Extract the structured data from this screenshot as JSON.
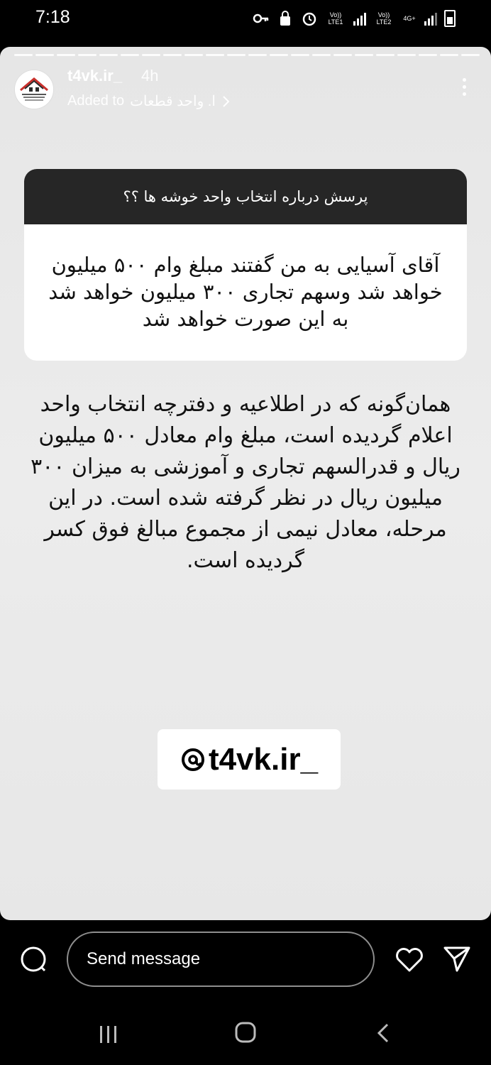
{
  "status_bar": {
    "time": "7:18",
    "sim1_label": "Vo)) LTE1",
    "sim2_label": "Vo)) LTE2",
    "network_label": "4G+"
  },
  "story": {
    "username": "t4vk.ir_",
    "time_ago": "4h",
    "added_prefix": "Added to",
    "highlight_name": "ا. واحد قطعات",
    "question_title": "پرسش درباره انتخاب واحد خوشه ها ؟؟",
    "question_body": "آقای آسیایی به من گفتند مبلغ وام ۵۰۰ میلیون خواهد شد وسهم تجاری ۳۰۰ میلیون خواهد شد به این صورت خواهد شد",
    "answer_text": "همان‌گونه که در اطلاعیه و دفترچه انتخاب واحد اعلام گردیده است، مبلغ وام معادل ۵۰۰ میلیون ریال و قدرالسهم تجاری و آموزشی به میزان ۳۰۰ میلیون ریال در نظر گرفته شده است. در این مرحله، معادل نیمی از مجموع مبالغ فوق کسر گردیده است.",
    "mention_text": "t4vk.ir_"
  },
  "bottom_bar": {
    "message_placeholder": "Send message"
  },
  "colors": {
    "story_bg": "#e9e9e9",
    "question_header_bg": "#262626",
    "card_bg": "#ffffff"
  }
}
